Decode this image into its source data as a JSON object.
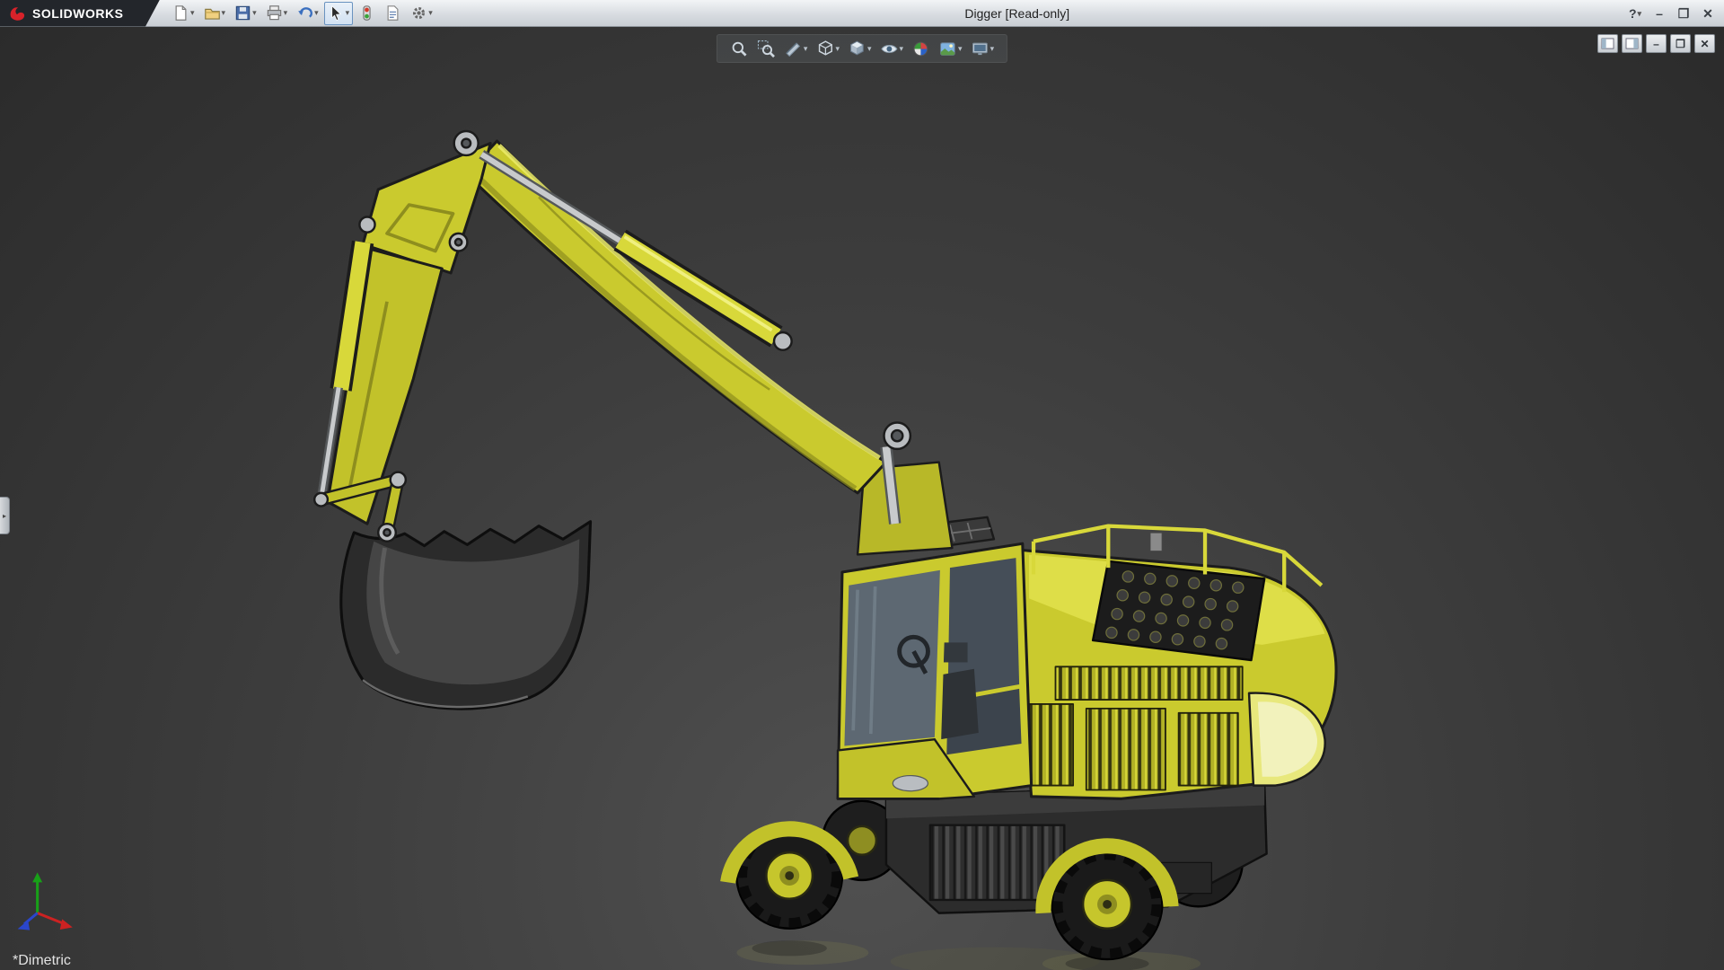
{
  "window": {
    "title": "Digger [Read-only]",
    "brand_text": "SOLIDWORKS",
    "controls": [
      {
        "name": "help",
        "glyph": "?",
        "caret": true
      },
      {
        "name": "minimize",
        "glyph": "–",
        "caret": false
      },
      {
        "name": "maximize",
        "glyph": "❐",
        "caret": false
      },
      {
        "name": "close",
        "glyph": "✕",
        "caret": false
      }
    ]
  },
  "toolbar": {
    "items": [
      {
        "name": "new-document",
        "caret": true
      },
      {
        "name": "open",
        "caret": true
      },
      {
        "name": "save",
        "caret": true
      },
      {
        "name": "print",
        "caret": true
      },
      {
        "name": "undo",
        "caret": true
      },
      {
        "name": "select",
        "caret": true,
        "active": true
      },
      {
        "name": "rebuild",
        "caret": false
      },
      {
        "name": "file-properties",
        "caret": false
      },
      {
        "name": "options",
        "caret": true
      }
    ]
  },
  "headsup": {
    "items": [
      {
        "name": "zoom-to-fit",
        "caret": false
      },
      {
        "name": "zoom-to-area",
        "caret": false
      },
      {
        "name": "section-view",
        "caret": true
      },
      {
        "name": "view-orientation",
        "caret": true
      },
      {
        "name": "display-style",
        "caret": true
      },
      {
        "name": "hide-show-items",
        "caret": true
      },
      {
        "name": "edit-appearance",
        "caret": false
      },
      {
        "name": "apply-scene",
        "caret": true
      },
      {
        "name": "view-settings",
        "caret": true
      }
    ]
  },
  "document_controls": {
    "items": [
      {
        "name": "pane-left",
        "type": "icon"
      },
      {
        "name": "pane-right",
        "type": "icon"
      },
      {
        "name": "doc-minimize",
        "type": "glyph",
        "glyph": "–"
      },
      {
        "name": "doc-restore",
        "type": "glyph",
        "glyph": "❐"
      },
      {
        "name": "doc-close",
        "type": "glyph",
        "glyph": "✕"
      }
    ]
  },
  "viewport": {
    "orientation_label": "*Dimetric",
    "model": "Digger",
    "triad": {
      "x_color": "#cc2222",
      "y_color": "#18a018",
      "z_color": "#2a46cc"
    }
  },
  "ui": {
    "caret_glyph": "▾"
  },
  "colors": {
    "excavator_yellow": "#caca2e",
    "excavator_highlight": "#ecec6a",
    "excavator_shadow": "#8e8e1e",
    "viewport_dark": "#2b2b2b",
    "viewport_light": "#505050",
    "brand_red": "#d8222a"
  }
}
